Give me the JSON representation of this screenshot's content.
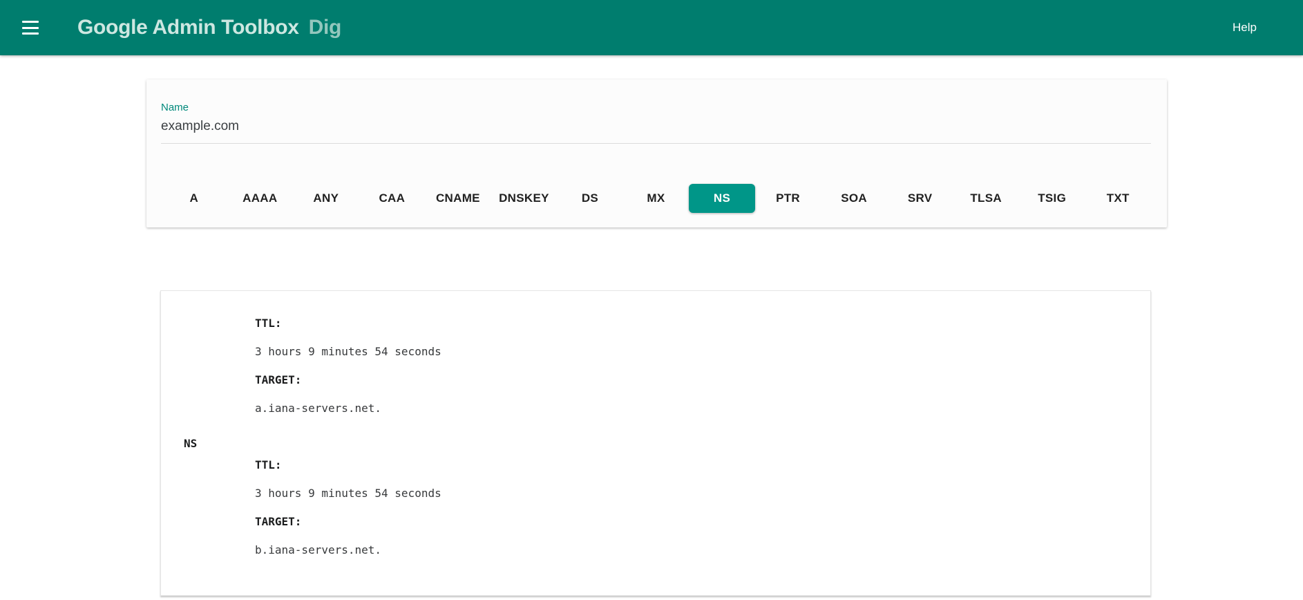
{
  "header": {
    "title": "Google Admin Toolbox",
    "app_name": "Dig",
    "help_label": "Help"
  },
  "colors": {
    "header_bg": "#007d6e",
    "accent": "#009688",
    "label_teal": "#00897b"
  },
  "query_form": {
    "name_label": "Name",
    "name_value": "example.com",
    "record_types": [
      {
        "label": "A",
        "selected": false
      },
      {
        "label": "AAAA",
        "selected": false
      },
      {
        "label": "ANY",
        "selected": false
      },
      {
        "label": "CAA",
        "selected": false
      },
      {
        "label": "CNAME",
        "selected": false
      },
      {
        "label": "DNSKEY",
        "selected": false
      },
      {
        "label": "DS",
        "selected": false
      },
      {
        "label": "MX",
        "selected": false
      },
      {
        "label": "NS",
        "selected": true
      },
      {
        "label": "PTR",
        "selected": false
      },
      {
        "label": "SOA",
        "selected": false
      },
      {
        "label": "SRV",
        "selected": false
      },
      {
        "label": "TLSA",
        "selected": false
      },
      {
        "label": "TSIG",
        "selected": false
      },
      {
        "label": "TXT",
        "selected": false
      }
    ]
  },
  "results": {
    "record_type": "NS",
    "ttl_label": "TTL:",
    "target_label": "TARGET:",
    "records": [
      {
        "ttl": "3 hours 9 minutes 54 seconds",
        "target": "a.iana-servers.net."
      },
      {
        "ttl": "3 hours 9 minutes 54 seconds",
        "target": "b.iana-servers.net."
      }
    ]
  }
}
